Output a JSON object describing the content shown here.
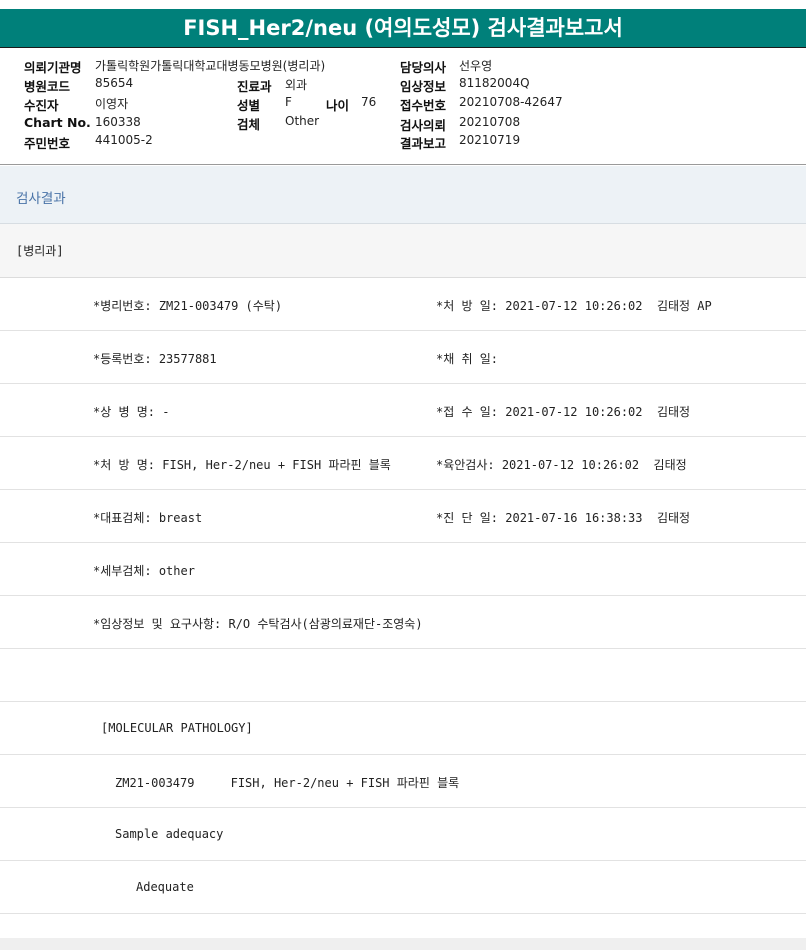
{
  "title": "FISH_Her2/neu (여의도성모) 검사결과보고서",
  "info": {
    "org_label": "의뢰기관명",
    "org": "가톨릭학원가톨릭대학교대병동모병원(병리과)",
    "hospcode_label": "병원코드",
    "hospcode": "85654",
    "patient_label": "수진자",
    "patient": "이영자",
    "chart_label": "Chart No.",
    "chart": "160338",
    "rrn_label": "주민번호",
    "rrn": "441005-2",
    "dept_label": "진료과",
    "dept": "외과",
    "sex_label": "성별",
    "sex": "F",
    "age_label": "나이",
    "age": "76",
    "specimen_label": "검체",
    "specimen": "Other",
    "doctor_label": "담당의사",
    "doctor": "선우영",
    "clinical_label": "임상정보",
    "clinical": "81182004Q",
    "receipt_label": "접수번호",
    "receipt": "20210708-42647",
    "request_label": "검사의뢰",
    "request": "20210708",
    "report_label": "결과보고",
    "report": "20210719"
  },
  "section_title": "검사결과",
  "department": "[병리과]",
  "rows": [
    {
      "left": "*병리번호: ZM21-003479 (수탁)",
      "right": "*처 방 일: 2021-07-12 10:26:02  김태정 AP"
    },
    {
      "left": "*등록번호: 23577881",
      "right": "*채 취 일:"
    },
    {
      "left": "*상 병 명: -",
      "right": "*접 수 일: 2021-07-12 10:26:02  김태정"
    },
    {
      "left": "*처 방 명: FISH, Her-2/neu + FISH 파라핀 블록",
      "right": "*육안검사: 2021-07-12 10:26:02  김태정"
    },
    {
      "left": "*대표검체: breast",
      "right": "*진 단 일: 2021-07-16 16:38:33  김태정"
    },
    {
      "left": "*세부검체: other",
      "right": ""
    },
    {
      "left": "*임상정보 및 요구사항: R/O 수탁검사(삼광의료재단-조영숙)",
      "right": ""
    },
    {
      "left": "",
      "right": ""
    },
    {
      "left": "[MOLECULAR PATHOLOGY]",
      "right": ""
    },
    {
      "left": "ZM21-003479     FISH, Her-2/neu + FISH 파라핀 블록",
      "right": ""
    },
    {
      "left": "Sample adequacy",
      "right": ""
    },
    {
      "left": "Adequate",
      "right": ""
    }
  ]
}
